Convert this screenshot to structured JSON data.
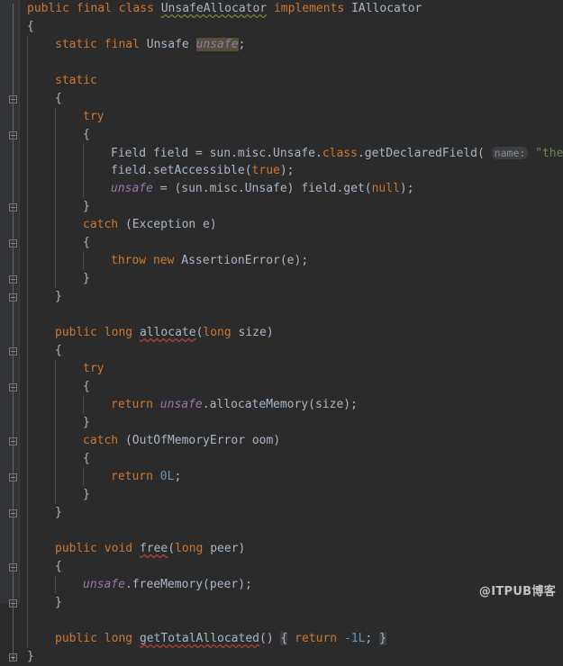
{
  "editor": {
    "language": "java",
    "theme": "darcula",
    "colors": {
      "background": "#2b2b2b",
      "gutter": "#313335",
      "default_text": "#a9b7c6",
      "keyword": "#cc7832",
      "string": "#6a8759",
      "number": "#6897bb",
      "static_field": "#9876aa",
      "param_hint": "#8c8c8c",
      "caret_highlight": "#52503a",
      "folded_chip": "#3c3f41",
      "indent_guide": "#4b4b4b",
      "error_squiggle": "#b04040",
      "typo_squiggle": "#7f7f3f"
    }
  },
  "code": {
    "lines": [
      {
        "indent": 0,
        "tokens": [
          {
            "t": "public",
            "c": "kw"
          },
          {
            "t": " ",
            "c": "txt"
          },
          {
            "t": "final",
            "c": "kw"
          },
          {
            "t": " ",
            "c": "txt"
          },
          {
            "t": "class",
            "c": "kw"
          },
          {
            "t": " ",
            "c": "txt"
          },
          {
            "t": "UnsafeAllocator",
            "c": "cls",
            "mark": "typo"
          },
          {
            "t": " ",
            "c": "txt"
          },
          {
            "t": "implements",
            "c": "kw"
          },
          {
            "t": " ",
            "c": "txt"
          },
          {
            "t": "IAllocator",
            "c": "cls"
          }
        ]
      },
      {
        "indent": 0,
        "tokens": [
          {
            "t": "{",
            "c": "txt"
          }
        ]
      },
      {
        "indent": 1,
        "tokens": [
          {
            "t": "static",
            "c": "kw"
          },
          {
            "t": " ",
            "c": "txt"
          },
          {
            "t": "final",
            "c": "kw"
          },
          {
            "t": " ",
            "c": "txt"
          },
          {
            "t": "Unsafe",
            "c": "cls"
          },
          {
            "t": " ",
            "c": "txt"
          },
          {
            "t": "unsafe",
            "c": "fld",
            "mark": "caret"
          },
          {
            "t": ";",
            "c": "txt"
          }
        ]
      },
      {
        "indent": 1,
        "tokens": []
      },
      {
        "indent": 1,
        "tokens": [
          {
            "t": "static",
            "c": "kw"
          }
        ]
      },
      {
        "indent": 1,
        "tokens": [
          {
            "t": "{",
            "c": "txt"
          }
        ]
      },
      {
        "indent": 2,
        "tokens": [
          {
            "t": "try",
            "c": "kw"
          }
        ]
      },
      {
        "indent": 2,
        "tokens": [
          {
            "t": "{",
            "c": "txt"
          }
        ]
      },
      {
        "indent": 3,
        "tokens": [
          {
            "t": "Field",
            "c": "cls"
          },
          {
            "t": " field = sun.misc.Unsafe",
            "c": "txt"
          },
          {
            "t": ".",
            "c": "txt"
          },
          {
            "t": "class",
            "c": "kw"
          },
          {
            "t": ".getDeclaredField(",
            "c": "txt"
          },
          {
            "t": " ",
            "c": "txt"
          },
          {
            "t": "name:",
            "c": "hint"
          },
          {
            "t": " ",
            "c": "txt"
          },
          {
            "t": "\"theUnsafe\"",
            "c": "str"
          },
          {
            "t": ");",
            "c": "txt"
          }
        ]
      },
      {
        "indent": 3,
        "tokens": [
          {
            "t": "field.setAccessible(",
            "c": "txt"
          },
          {
            "t": "true",
            "c": "kw"
          },
          {
            "t": ");",
            "c": "txt"
          }
        ]
      },
      {
        "indent": 3,
        "tokens": [
          {
            "t": "unsafe",
            "c": "fld"
          },
          {
            "t": " = (sun.misc.Unsafe) field.get(",
            "c": "txt"
          },
          {
            "t": "null",
            "c": "kw"
          },
          {
            "t": ");",
            "c": "txt"
          }
        ]
      },
      {
        "indent": 2,
        "tokens": [
          {
            "t": "}",
            "c": "txt"
          }
        ]
      },
      {
        "indent": 2,
        "tokens": [
          {
            "t": "catch",
            "c": "kw"
          },
          {
            "t": " (Exception e)",
            "c": "txt"
          }
        ]
      },
      {
        "indent": 2,
        "tokens": [
          {
            "t": "{",
            "c": "txt"
          }
        ]
      },
      {
        "indent": 3,
        "tokens": [
          {
            "t": "throw",
            "c": "kw"
          },
          {
            "t": " ",
            "c": "txt"
          },
          {
            "t": "new",
            "c": "kw"
          },
          {
            "t": " ",
            "c": "txt"
          },
          {
            "t": "AssertionError(e);",
            "c": "txt"
          }
        ]
      },
      {
        "indent": 2,
        "tokens": [
          {
            "t": "}",
            "c": "txt"
          }
        ]
      },
      {
        "indent": 1,
        "tokens": [
          {
            "t": "}",
            "c": "txt"
          }
        ]
      },
      {
        "indent": 1,
        "tokens": []
      },
      {
        "indent": 1,
        "tokens": [
          {
            "t": "public",
            "c": "kw"
          },
          {
            "t": " ",
            "c": "txt"
          },
          {
            "t": "long",
            "c": "kw"
          },
          {
            "t": " ",
            "c": "txt"
          },
          {
            "t": "allocate",
            "c": "mth",
            "mark": "error"
          },
          {
            "t": "(",
            "c": "txt"
          },
          {
            "t": "long",
            "c": "kw"
          },
          {
            "t": " size)",
            "c": "txt"
          }
        ]
      },
      {
        "indent": 1,
        "tokens": [
          {
            "t": "{",
            "c": "txt"
          }
        ]
      },
      {
        "indent": 2,
        "tokens": [
          {
            "t": "try",
            "c": "kw"
          }
        ]
      },
      {
        "indent": 2,
        "tokens": [
          {
            "t": "{",
            "c": "txt"
          }
        ]
      },
      {
        "indent": 3,
        "tokens": [
          {
            "t": "return",
            "c": "kw"
          },
          {
            "t": " ",
            "c": "txt"
          },
          {
            "t": "unsafe",
            "c": "fld"
          },
          {
            "t": ".allocateMemory(size);",
            "c": "txt"
          }
        ]
      },
      {
        "indent": 2,
        "tokens": [
          {
            "t": "}",
            "c": "txt"
          }
        ]
      },
      {
        "indent": 2,
        "tokens": [
          {
            "t": "catch",
            "c": "kw"
          },
          {
            "t": " (OutOfMemoryError oom)",
            "c": "txt"
          }
        ]
      },
      {
        "indent": 2,
        "tokens": [
          {
            "t": "{",
            "c": "txt"
          }
        ]
      },
      {
        "indent": 3,
        "tokens": [
          {
            "t": "return",
            "c": "kw"
          },
          {
            "t": " ",
            "c": "txt"
          },
          {
            "t": "0L",
            "c": "num"
          },
          {
            "t": ";",
            "c": "txt"
          }
        ]
      },
      {
        "indent": 2,
        "tokens": [
          {
            "t": "}",
            "c": "txt"
          }
        ]
      },
      {
        "indent": 1,
        "tokens": [
          {
            "t": "}",
            "c": "txt"
          }
        ]
      },
      {
        "indent": 1,
        "tokens": []
      },
      {
        "indent": 1,
        "tokens": [
          {
            "t": "public",
            "c": "kw"
          },
          {
            "t": " ",
            "c": "txt"
          },
          {
            "t": "void",
            "c": "kw"
          },
          {
            "t": " ",
            "c": "txt"
          },
          {
            "t": "free",
            "c": "mth",
            "mark": "error"
          },
          {
            "t": "(",
            "c": "txt"
          },
          {
            "t": "long",
            "c": "kw"
          },
          {
            "t": " peer)",
            "c": "txt"
          }
        ]
      },
      {
        "indent": 1,
        "tokens": [
          {
            "t": "{",
            "c": "txt"
          }
        ]
      },
      {
        "indent": 2,
        "tokens": [
          {
            "t": "unsafe",
            "c": "fld"
          },
          {
            "t": ".freeMemory(peer);",
            "c": "txt"
          }
        ]
      },
      {
        "indent": 1,
        "tokens": [
          {
            "t": "}",
            "c": "txt"
          }
        ]
      },
      {
        "indent": 1,
        "tokens": []
      },
      {
        "indent": 1,
        "tokens": [
          {
            "t": "public",
            "c": "kw"
          },
          {
            "t": " ",
            "c": "txt"
          },
          {
            "t": "long",
            "c": "kw"
          },
          {
            "t": " ",
            "c": "txt"
          },
          {
            "t": "getTotalAllocated",
            "c": "mth",
            "mark": "error"
          },
          {
            "t": "()",
            "c": "txt"
          },
          {
            "t": " ",
            "c": "txt"
          },
          {
            "t": "{",
            "c": "fold-chip"
          },
          {
            "t": " ",
            "c": "txt"
          },
          {
            "t": "return",
            "c": "kw"
          },
          {
            "t": " ",
            "c": "txt"
          },
          {
            "t": "-1L",
            "c": "num"
          },
          {
            "t": ";",
            "c": "txt"
          },
          {
            "t": " ",
            "c": "txt"
          },
          {
            "t": "}",
            "c": "fold-chip"
          }
        ]
      },
      {
        "indent": 0,
        "tokens": [
          {
            "t": "}",
            "c": "txt"
          }
        ]
      }
    ]
  },
  "gutter": {
    "fold_markers": [
      {
        "line": 5,
        "type": "minus"
      },
      {
        "line": 7,
        "type": "minus"
      },
      {
        "line": 11,
        "type": "minus"
      },
      {
        "line": 13,
        "type": "minus"
      },
      {
        "line": 15,
        "type": "minus"
      },
      {
        "line": 16,
        "type": "minus"
      },
      {
        "line": 19,
        "type": "minus"
      },
      {
        "line": 21,
        "type": "minus"
      },
      {
        "line": 24,
        "type": "minus"
      },
      {
        "line": 26,
        "type": "minus"
      },
      {
        "line": 28,
        "type": "minus"
      },
      {
        "line": 31,
        "type": "minus"
      },
      {
        "line": 33,
        "type": "minus"
      },
      {
        "line": 36,
        "type": "plus"
      }
    ]
  },
  "watermark": {
    "text": "@ITPUB博客"
  }
}
